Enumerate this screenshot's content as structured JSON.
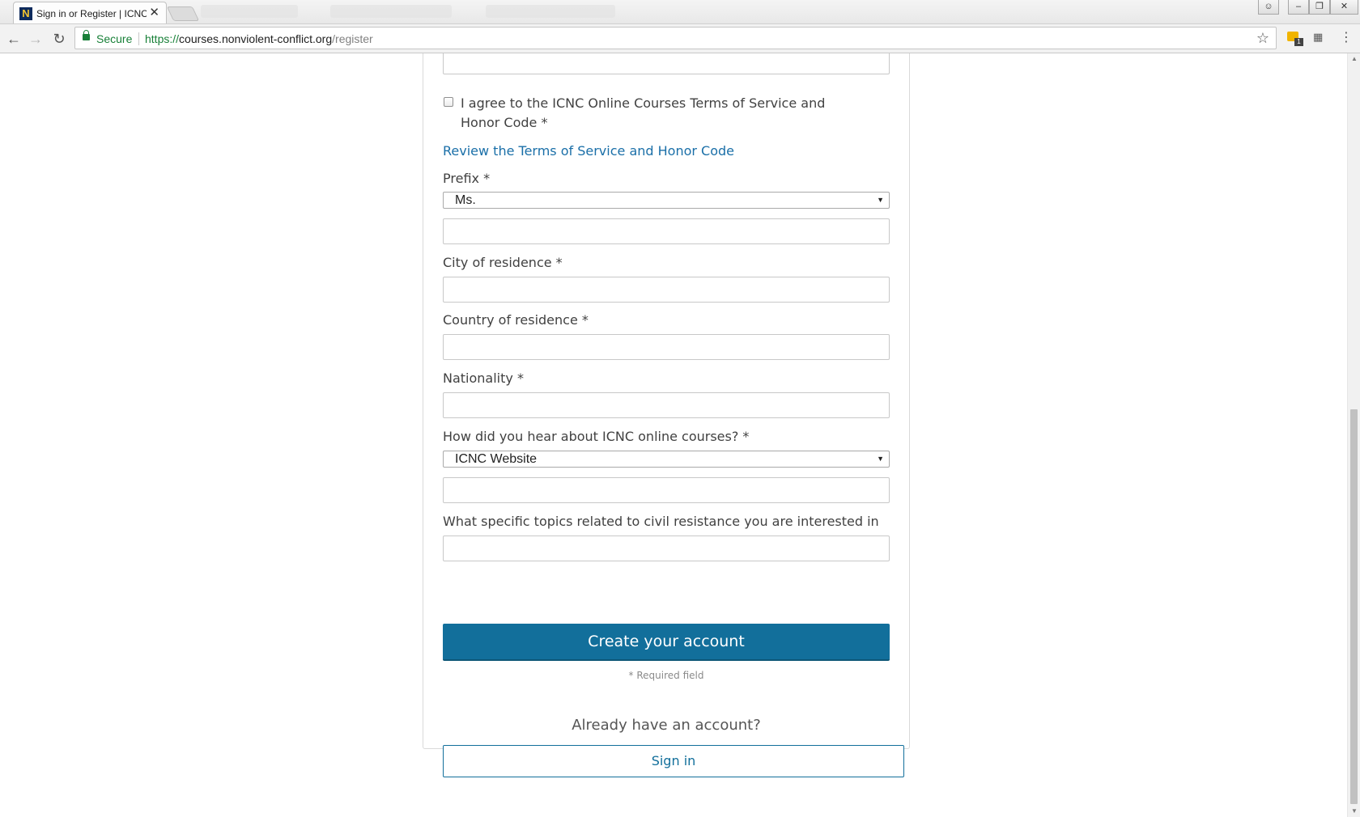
{
  "browser": {
    "tab_title": "Sign in or Register | ICNC",
    "tab_favicon_letter": "N",
    "tab_close": "✕",
    "secure_label": "Secure",
    "url_scheme": "https://",
    "url_host": "courses.nonviolent-conflict.org",
    "url_path": "/register",
    "extension_badge": "1"
  },
  "form": {
    "agree_label": "I agree to the ICNC Online Courses Terms of Service and Honor Code *",
    "review_link": "Review the Terms of Service and Honor Code",
    "prefix_label": "Prefix *",
    "prefix_value": "Ms.",
    "city_label": "City of residence *",
    "country_label": "Country of residence *",
    "nationality_label": "Nationality *",
    "hear_label": "How did you hear about ICNC online courses? *",
    "hear_value": "ICNC Website",
    "topics_label": "What specific topics related to civil resistance you are interested in",
    "submit_label": "Create your account",
    "required_note": "* Required field"
  },
  "signin": {
    "prompt": "Already have an account?",
    "button_label": "Sign in"
  },
  "colors": {
    "accent": "#126f9b",
    "link": "#1a6fa8",
    "secure_green": "#188038"
  }
}
